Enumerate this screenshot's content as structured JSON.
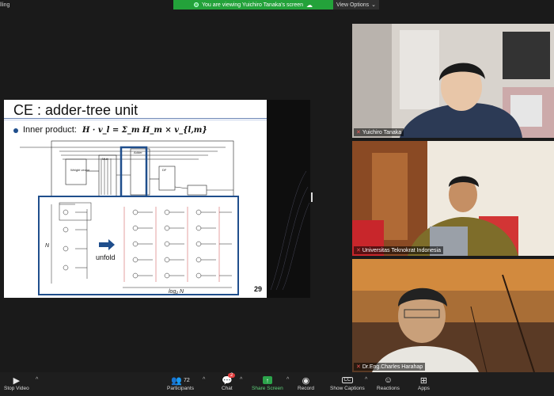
{
  "window": {
    "corner_label": "lling"
  },
  "banner": {
    "text": "You are viewing Yuichiro Tanaka's screen",
    "view_options": "View Options"
  },
  "slide": {
    "title": "CE : adder-tree unit",
    "bullet_label": "Inner product:",
    "formula": "H · v_l = Σ_m H_m × v_{l,m}",
    "unfold_label": "unfold",
    "axis_n": "N",
    "axis_log": "log₂ N",
    "block_labels": [
      "Weight vector",
      "Mult",
      "Adder",
      "DF"
    ],
    "page_number": "29"
  },
  "participants": [
    {
      "name": "Yuichiro Tanaka"
    },
    {
      "name": "Universitas Teknokrat Indonesia"
    },
    {
      "name": "Dr.Eng.Charles Harahap"
    }
  ],
  "toolbar": {
    "stop_video": "Stop Video",
    "participants": "Participants",
    "participants_count": "72",
    "chat": "Chat",
    "chat_badge": "2",
    "share_screen": "Share Screen",
    "record": "Record",
    "show_captions": "Show Captions",
    "reactions": "Reactions",
    "apps": "Apps"
  },
  "icons": {
    "video": "video-camera-icon",
    "people": "participants-icon",
    "chat": "chat-bubble-icon",
    "share": "share-arrow-icon",
    "record": "record-icon",
    "cc": "captions-icon",
    "react": "reaction-icon",
    "apps": "apps-icon"
  },
  "colors": {
    "banner_bg": "#23a23a",
    "slide_accent": "#1f4e8c",
    "share_green": "#2ca44b"
  }
}
